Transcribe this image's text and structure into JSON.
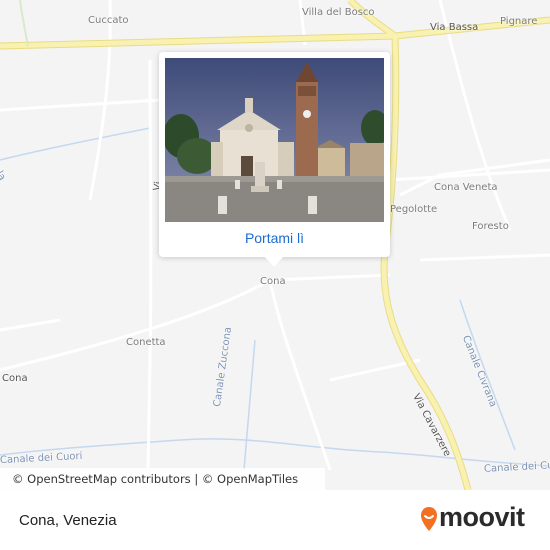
{
  "map": {
    "labels": {
      "cuccato": "Cuccato",
      "villa_del_bosco": "Villa del Bosco",
      "via_bassa": "Via Bassa",
      "pignare": "Pignare",
      "cona_veneta": "Cona Veneta",
      "pegolotte": "Pegolotte",
      "foresto": "Foresto",
      "cona": "Cona",
      "conetta": "Conetta",
      "cona_left": "Cona",
      "canale_zuccona": "Canale Zuccona",
      "via_cavarzere": "Via Cavarzere",
      "canale_civrana": "Canale Civrana",
      "canale_dei_cuori_left": "Canale dei Cuori",
      "canale_dei_cuori_right": "Canale dei Cu",
      "partial_left": "ola",
      "partial_via": "Vi"
    }
  },
  "popup": {
    "photo_subject": "church-with-bell-tower",
    "button_label": "Portami lì"
  },
  "attribution": {
    "text": "© OpenStreetMap contributors | © OpenMapTiles"
  },
  "footer": {
    "place": "Cona, Venezia",
    "brand": "moovit",
    "brand_color": "#f36f21"
  },
  "colors": {
    "major_road": "#f7eea0",
    "major_road_casing": "#e3d77a",
    "water": "#bcd3ec",
    "minor_road": "#ffffff"
  }
}
